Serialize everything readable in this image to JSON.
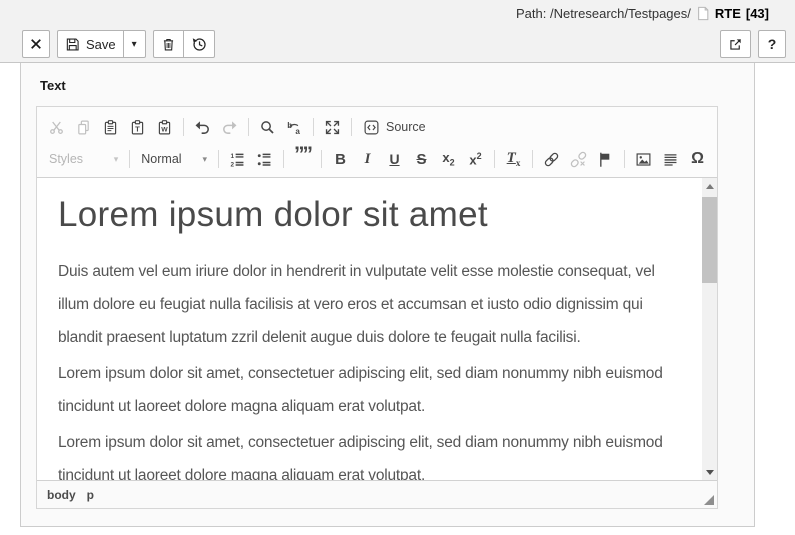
{
  "header": {
    "path_label": "Path: /Netresearch/Testpages/",
    "record_title": "RTE",
    "record_uid": "[43]"
  },
  "doc_toolbar": {
    "save_label": "Save",
    "help_label": "?"
  },
  "panel": {
    "field_label": "Text"
  },
  "rte": {
    "toolbar": {
      "styles_label": "Styles",
      "format_label": "Normal",
      "source_label": "Source",
      "glyphs": {
        "caret": "▾",
        "quote": "””",
        "bold": "B",
        "italic": "I",
        "underline": "U",
        "strikethrough": "S",
        "script_base": "x",
        "script_small": "2",
        "removeformat_base": "T",
        "removeformat_small": "x",
        "specialchar": "Ω"
      },
      "icon_letters": {
        "paste_text": "T",
        "paste_word": "W",
        "replace_from": "b",
        "replace_to": "a",
        "list_one": "1",
        "list_two": "2"
      }
    },
    "content": {
      "heading": "Lorem ipsum dolor sit amet",
      "paragraphs": [
        "Duis autem vel eum iriure dolor in hendrerit in vulputate velit esse molestie consequat, vel illum dolore eu feugiat nulla facilisis at vero eros et accumsan et iusto odio dignissim qui blandit praesent luptatum zzril delenit augue duis dolore te feugait nulla facilisi.",
        "Lorem ipsum dolor sit amet, consectetuer adipiscing elit, sed diam nonummy nibh euismod tincidunt ut laoreet dolore magna aliquam erat volutpat.",
        "Lorem ipsum dolor sit amet, consectetuer adipiscing elit, sed diam nonummy nibh euismod tincidunt ut laoreet dolore magna aliquam erat volutpat."
      ]
    },
    "status_bar": {
      "elements": [
        "body",
        "p"
      ]
    }
  },
  "colors": {
    "header_bg": "#f2f2f2",
    "panel_bg": "#fafafa",
    "toolbar_bg": "#fcfcfc",
    "icon": "#474747",
    "icon_disabled": "#c0c0c0",
    "border": "#cccccc",
    "heading_text": "#4a4a4a",
    "body_text": "#565656"
  }
}
